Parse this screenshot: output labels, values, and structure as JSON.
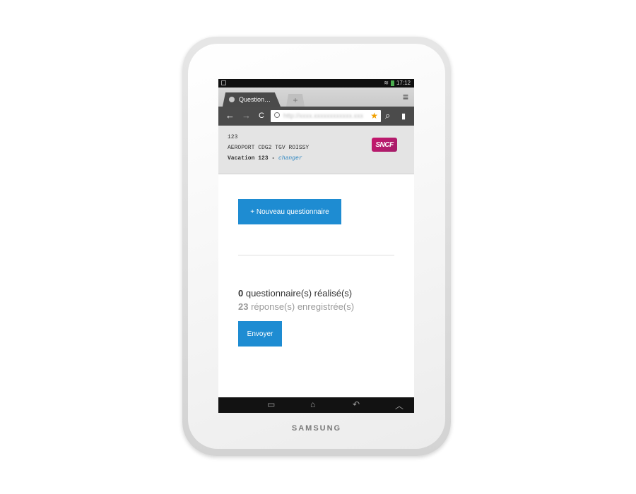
{
  "device": {
    "brand": "SAMSUNG"
  },
  "status_bar": {
    "time": "17:12"
  },
  "browser": {
    "tab_title": "Question…",
    "new_tab_symbol": "+",
    "tab_close_symbol": "╱",
    "url_text": "http://xxxx.xxxxxxxxxxxx.xxx",
    "icons": {
      "menu": "≡",
      "back": "←",
      "forward": "→",
      "reload": "C",
      "star": "★",
      "search": "⌕",
      "bookmark": "▮"
    }
  },
  "header": {
    "code": "123",
    "station": "AEROPORT CDG2 TGV ROISSY",
    "vacation_label": "Vacation 123 - ",
    "change_link": "changer",
    "logo_text": "SNCF"
  },
  "main": {
    "new_button_label": "+ Nouveau questionnaire",
    "completed_count": "0",
    "completed_label": " questionnaire(s) réalisé(s)",
    "responses_count": "23",
    "responses_label": " réponse(s) enregistrée(s)",
    "send_button_label": "Envoyer"
  },
  "system_nav": {
    "recent_icon": "▭",
    "home_icon": "⌂",
    "back_icon": "↶",
    "up_icon": "︿"
  },
  "colors": {
    "primary_button": "#1e8cd2",
    "link": "#2e86c1",
    "sncf": "#c6166d"
  }
}
